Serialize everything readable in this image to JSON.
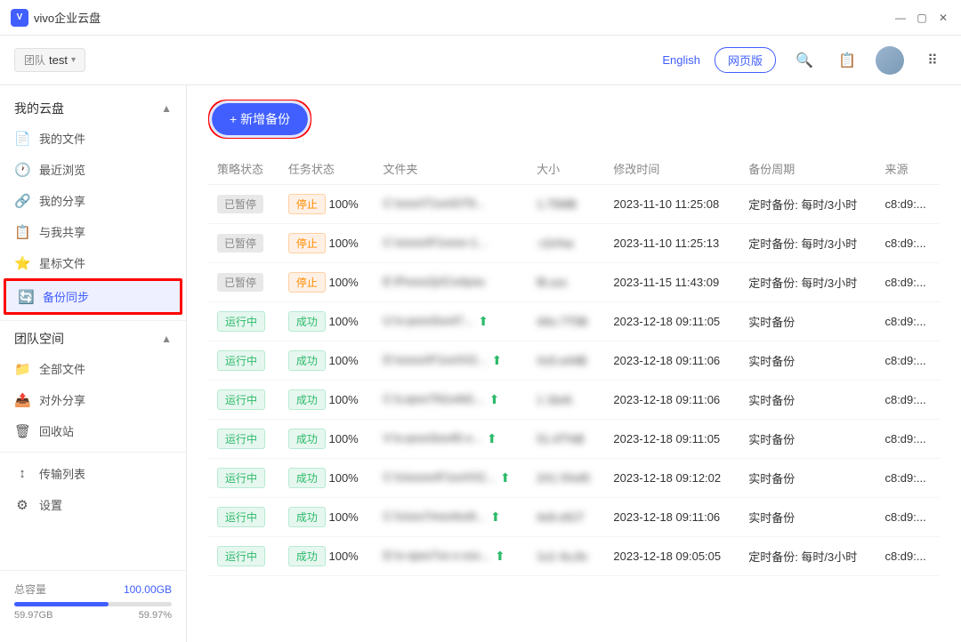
{
  "app": {
    "title": "vivo企业云盘",
    "logo_text": "vivo企业云盘"
  },
  "toolbar": {
    "team_label": "团队",
    "team_name": "test",
    "lang": "English",
    "webview_btn": "网页版"
  },
  "sidebar": {
    "my_disk_title": "我的云盘",
    "items": [
      {
        "id": "my-files",
        "label": "我的文件",
        "icon": "📄"
      },
      {
        "id": "recent",
        "label": "最近浏览",
        "icon": "🕐"
      },
      {
        "id": "my-share",
        "label": "我的分享",
        "icon": "🔗"
      },
      {
        "id": "shared-with-me",
        "label": "与我共享",
        "icon": "📋"
      },
      {
        "id": "starred",
        "label": "星标文件",
        "icon": "⭐"
      },
      {
        "id": "backup-sync",
        "label": "备份同步",
        "icon": "🔄",
        "active": true
      }
    ],
    "team_space_title": "团队空间",
    "team_items": [
      {
        "id": "all-files",
        "label": "全部文件",
        "icon": "📁"
      },
      {
        "id": "external-share",
        "label": "对外分享",
        "icon": "📤"
      },
      {
        "id": "recycle",
        "label": "回收站",
        "icon": "🗑"
      }
    ],
    "other_items": [
      {
        "id": "transfer-list",
        "label": "传输列表",
        "icon": "↕"
      },
      {
        "id": "settings",
        "label": "设置",
        "icon": "⚙"
      }
    ],
    "storage_label": "总容量",
    "storage_total": "100.00GB",
    "storage_used": "59.97GB",
    "storage_pct": "59.97%",
    "storage_fill_width": "59.97"
  },
  "content": {
    "add_backup_btn": "+ 新增备份",
    "table_headers": [
      "策略状态",
      "任务状态",
      "文件夹",
      "大小",
      "修改时间",
      "备份周期",
      "来源"
    ],
    "rows": [
      {
        "policy_status": "已暂停",
        "policy_class": "paused",
        "task_status": "停止",
        "task_class": "stop",
        "pct": "100%",
        "folder": "C:\\xxxx\\T1xx\\GT9...",
        "size": "1.75MB",
        "time": "2023-11-10 11:25:08",
        "period": "定时备份: 每时/3小时",
        "source": "c8:d9:..."
      },
      {
        "policy_status": "已暂停",
        "policy_class": "paused",
        "task_status": "停止",
        "task_class": "stop",
        "pct": "100%",
        "folder": "C:\\xxxxx\\F1xxxx-1...",
        "size": "-r2x%a",
        "time": "2023-11-10 11:25:13",
        "period": "定时备份: 每时/3小时",
        "source": "c8:d9:..."
      },
      {
        "policy_status": "已暂停",
        "policy_class": "paused",
        "task_status": "停止",
        "task_class": "stop",
        "pct": "100%",
        "folder": "E:\\Pxxxx2y\\Cxxlyou",
        "size": "f8.xxx",
        "time": "2023-11-15 11:43:09",
        "period": "定时备份: 每时/3小时",
        "source": "c8:d9:..."
      },
      {
        "policy_status": "运行中",
        "policy_class": "running",
        "task_status": "成功",
        "task_class": "success",
        "pct": "100%",
        "folder": "U:\\x-pxxxSxx47...",
        "size": "4Ax.7T5B",
        "time": "2023-12-18 09:11:05",
        "period": "实时备份",
        "source": "c8:d9:..."
      },
      {
        "policy_status": "运行中",
        "policy_class": "running",
        "task_status": "成功",
        "task_class": "success",
        "pct": "100%",
        "folder": "D:\\xxxxx\\F1xxXX2...",
        "size": "Xx5.e44B",
        "time": "2023-12-18 09:11:06",
        "period": "实时备份",
        "source": "c8:d9:..."
      },
      {
        "policy_status": "运行中",
        "policy_class": "running",
        "task_status": "成功",
        "task_class": "success",
        "pct": "100%",
        "folder": "C:\\Lxpxx7N1x4d1...",
        "size": "1 1bx6.",
        "time": "2023-12-18 09:11:06",
        "period": "实时备份",
        "source": "c8:d9:..."
      },
      {
        "policy_status": "运行中",
        "policy_class": "running",
        "task_status": "成功",
        "task_class": "success",
        "pct": "100%",
        "folder": "V:\\x-pxxxSxx45-x...",
        "size": "51.4T%B",
        "time": "2023-12-18 09:11:05",
        "period": "实时备份",
        "source": "c8:d9:..."
      },
      {
        "policy_status": "运行中",
        "policy_class": "running",
        "task_status": "成功",
        "task_class": "success",
        "pct": "100%",
        "folder": "C:\\Uxxxxx\\F1xxXX2...",
        "size": "2X1 5%45",
        "time": "2023-12-18 09:12:02",
        "period": "实时备份",
        "source": "c8:d9:..."
      },
      {
        "policy_status": "运行中",
        "policy_class": "running",
        "task_status": "成功",
        "task_class": "success",
        "pct": "100%",
        "folder": "C:\\Uxxx7mxx4xx9...",
        "size": "4x9.x91T",
        "time": "2023-12-18 09:11:06",
        "period": "实时备份",
        "source": "c8:d9:..."
      },
      {
        "policy_status": "运行中",
        "policy_class": "running",
        "task_status": "成功",
        "task_class": "success",
        "pct": "100%",
        "folder": "D:\\x-xpxx7xx-x-xxx...",
        "size": "1u1 4u,6x",
        "time": "2023-12-18 09:05:05",
        "period": "定时备份: 每时/3小时",
        "source": "c8:d9:..."
      }
    ]
  }
}
